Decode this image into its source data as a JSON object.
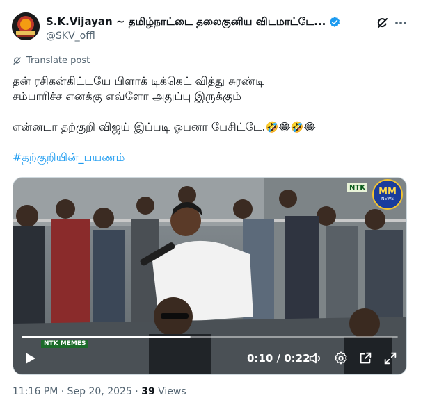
{
  "post": {
    "display_name": "S.K.Vijayan ~ தமிழ்நாட்டை தலைகுனிய விடமாட்டே...",
    "handle": "@SKV_offl",
    "translate_label": "Translate post",
    "lines": [
      "தன் ரசிகன்கிட்டயே பிளாக் டிக்கெட் வித்து சுரண்டி",
      "சம்பாரிச்ச எனக்கு எவ்ளோ அதுப்பு இருக்கும்",
      "என்னடா தற்குறி விஜய் இப்படி ஓபனா பேசிட்டே.",
      "#தற்குறியின்_பயணம்"
    ],
    "emojis": "🤣😂🤣😂",
    "timestamp": "11:16 PM · Sep 20, 2025 · ",
    "views_count": "39",
    "views_label": " Views"
  },
  "video": {
    "current_time": "0:10",
    "separator": " / ",
    "duration": "0:22",
    "progress": 0.45,
    "watermark_top": "NTK",
    "watermark_bottom": "NTK MEMES",
    "channel_logo": "MM",
    "channel_logo_sub": "NEWS"
  },
  "icons": {
    "verified": "verified-badge-icon",
    "grok": "grok-icon",
    "more": "more-icon",
    "play": "play-icon",
    "volume": "volume-icon",
    "settings": "settings-icon",
    "popout": "popout-icon",
    "fullscreen": "fullscreen-icon"
  },
  "colors": {
    "accent": "#1d9bf0",
    "text": "#0f1419",
    "muted": "#536471"
  }
}
